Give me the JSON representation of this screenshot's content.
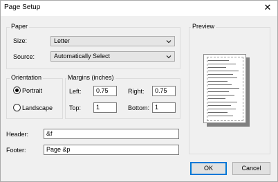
{
  "window": {
    "title": "Page Setup"
  },
  "paper": {
    "legend": "Paper",
    "size_label": "Size:",
    "size_value": "Letter",
    "source_label": "Source:",
    "source_value": "Automatically Select"
  },
  "orientation": {
    "legend": "Orientation",
    "portrait_label": "Portrait",
    "landscape_label": "Landscape",
    "selected": "Portrait"
  },
  "margins": {
    "legend": "Margins (inches)",
    "left_label": "Left:",
    "left_value": "0.75",
    "right_label": "Right:",
    "right_value": "0.75",
    "top_label": "Top:",
    "top_value": "1",
    "bottom_label": "Bottom:",
    "bottom_value": "1"
  },
  "header": {
    "label": "Header:",
    "value": "&f"
  },
  "footer": {
    "label": "Footer:",
    "value": "Page &p"
  },
  "preview": {
    "legend": "Preview"
  },
  "buttons": {
    "ok": "OK",
    "cancel": "Cancel"
  }
}
